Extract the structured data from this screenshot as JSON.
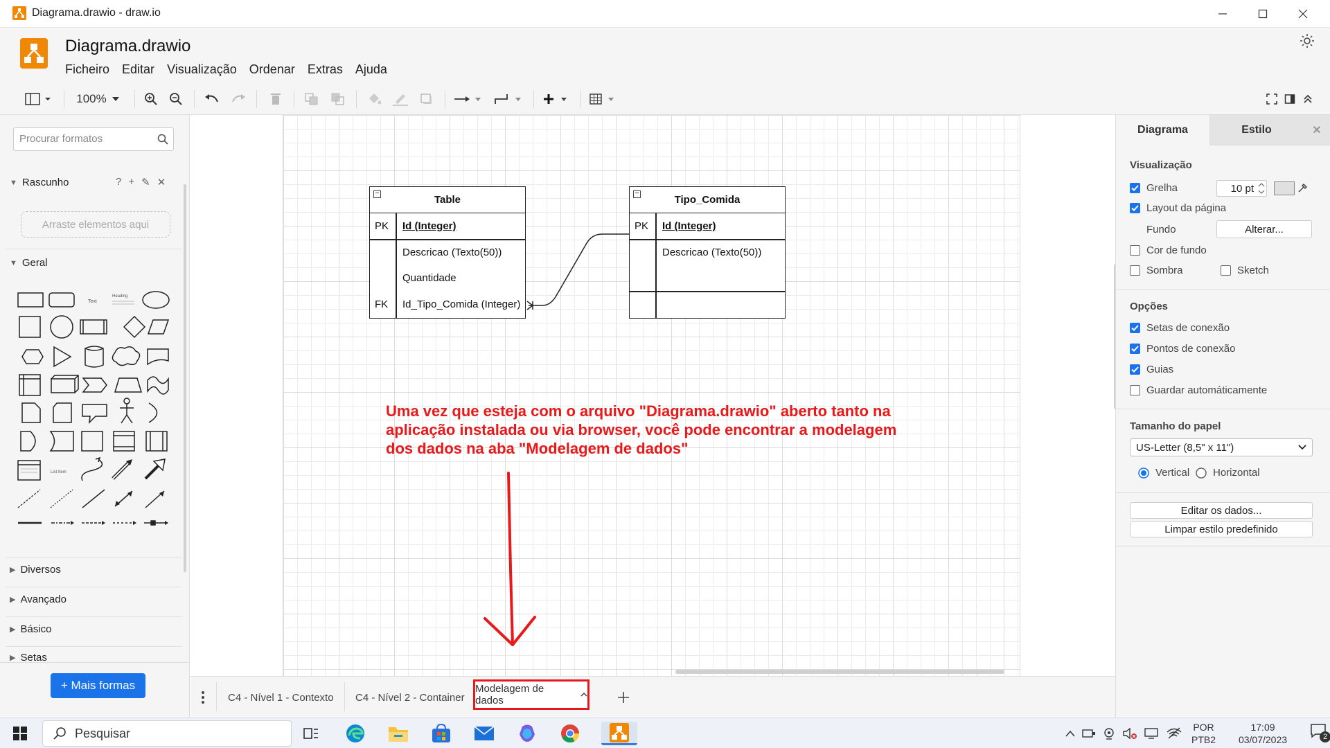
{
  "window": {
    "title": "Diagrama.drawio - draw.io"
  },
  "header": {
    "doc_title": "Diagrama.drawio",
    "menus": [
      "Ficheiro",
      "Editar",
      "Visualização",
      "Ordenar",
      "Extras",
      "Ajuda"
    ]
  },
  "toolbar": {
    "zoom": "100%"
  },
  "left_panel": {
    "search_placeholder": "Procurar formatos",
    "scratchpad": {
      "title": "Rascunho",
      "help": "?",
      "drop_hint": "Arraste elementos aqui"
    },
    "general": {
      "title": "Geral",
      "text_shape": "Text",
      "heading_shape": "Heading",
      "list_item": "List Item"
    },
    "sections": [
      "Diversos",
      "Avançado",
      "Básico",
      "Setas"
    ],
    "more_shapes": "+ Mais formas"
  },
  "diagram": {
    "tables": [
      {
        "name": "Table",
        "rows": [
          {
            "key": "PK",
            "field": "Id (Integer)"
          },
          {
            "key": "",
            "field": "Descricao (Texto(50))"
          },
          {
            "key": "",
            "field": "Quantidade"
          },
          {
            "key": "FK",
            "field": "Id_Tipo_Comida (Integer)"
          }
        ]
      },
      {
        "name": "Tipo_Comida",
        "rows": [
          {
            "key": "PK",
            "field": "Id (Integer)"
          },
          {
            "key": "",
            "field": "Descricao (Texto(50))"
          }
        ]
      }
    ],
    "annotation": "Uma vez que esteja com o arquivo \"Diagrama.drawio\" aberto tanto na aplicação instalada ou via browser, você pode encontrar a modelagem dos dados na aba \"Modelagem de dados\""
  },
  "page_tabs": {
    "items": [
      "C4 - Nível 1 - Contexto",
      "C4 - Nível 2 - Container"
    ],
    "active": "Modelagem de dados"
  },
  "right_panel": {
    "tabs": [
      "Diagrama",
      "Estilo"
    ],
    "view": {
      "title": "Visualização",
      "grid": "Grelha",
      "grid_size": "10 pt",
      "page_layout": "Layout da página",
      "background": "Fundo",
      "change": "Alterar...",
      "bg_color": "Cor de fundo",
      "shadow": "Sombra",
      "sketch": "Sketch"
    },
    "options": {
      "title": "Opções",
      "items": [
        "Setas de conexão",
        "Pontos de conexão",
        "Guias",
        "Guardar automáticamente"
      ],
      "checked": [
        true,
        true,
        true,
        false
      ]
    },
    "paper": {
      "title": "Tamanho do papel",
      "size": "US-Letter (8,5\" x 11\")",
      "portrait": "Vertical",
      "landscape": "Horizontal"
    },
    "edit_data": "Editar os dados...",
    "clear_style": "Limpar estilo predefinido"
  },
  "taskbar": {
    "search": "Pesquisar",
    "lang1": "POR",
    "lang2": "PTB2",
    "time": "17:09",
    "date": "03/07/2023",
    "notifications": "2"
  },
  "colors": {
    "accent": "#1a73e8",
    "drawio_orange": "#f08705",
    "annotation_red": "#e8191a"
  }
}
